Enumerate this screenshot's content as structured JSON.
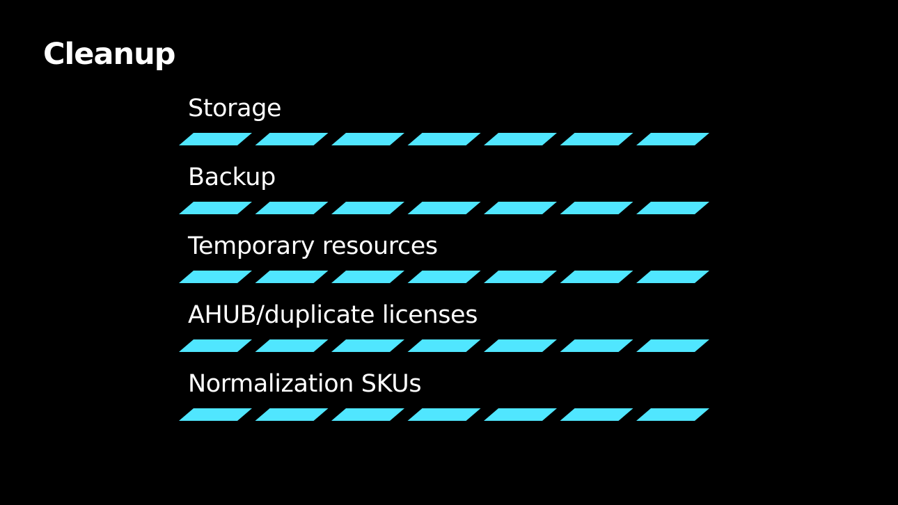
{
  "slide": {
    "title": "Cleanup"
  },
  "accent_color": "#50e6ff",
  "background_color": "#000000",
  "items": [
    {
      "label": "Storage"
    },
    {
      "label": "Backup"
    },
    {
      "label": "Temporary resources"
    },
    {
      "label": "AHUB/duplicate licenses"
    },
    {
      "label": "Normalization SKUs"
    }
  ],
  "segments_per_bar": 7
}
